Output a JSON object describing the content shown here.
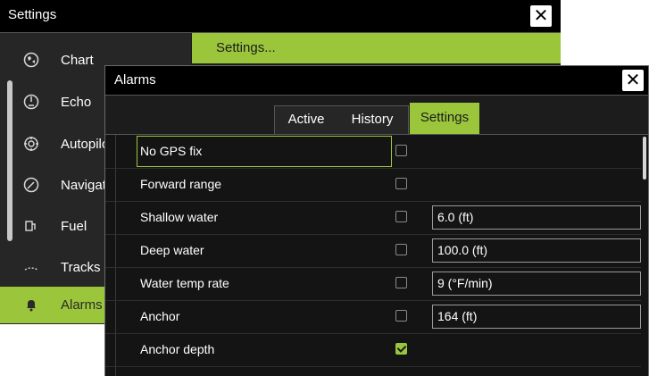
{
  "settings_window": {
    "title": "Settings",
    "close_label": "✕",
    "header_text": "Settings...",
    "sidebar": [
      {
        "label": "Chart",
        "icon": "globe-icon",
        "glyph": "🌐"
      },
      {
        "label": "Echo",
        "icon": "sonar-icon",
        "glyph": "◔"
      },
      {
        "label": "Autopilot",
        "icon": "helm-icon",
        "glyph": "⎈"
      },
      {
        "label": "Navigation",
        "icon": "compass-icon",
        "glyph": "⊘"
      },
      {
        "label": "Fuel",
        "icon": "fuel-pump-icon",
        "glyph": "⛽"
      },
      {
        "label": "Tracks",
        "icon": "track-icon",
        "glyph": "⤳"
      },
      {
        "label": "Alarms",
        "icon": "bell-icon",
        "glyph": "🔔"
      }
    ]
  },
  "alarms_dialog": {
    "title": "Alarms",
    "close_label": "✕",
    "tabs": [
      {
        "label": "Active",
        "active": false
      },
      {
        "label": "History",
        "active": false
      },
      {
        "label": "Settings",
        "active": true
      }
    ],
    "rows": [
      {
        "name": "No GPS fix",
        "checked": false,
        "value": null
      },
      {
        "name": "Forward range",
        "checked": false,
        "value": null
      },
      {
        "name": "Shallow water",
        "checked": false,
        "value": "6.0 (ft)"
      },
      {
        "name": "Deep water",
        "checked": false,
        "value": "100.0 (ft)"
      },
      {
        "name": "Water temp rate",
        "checked": false,
        "value": "9 (°F/min)"
      },
      {
        "name": "Anchor",
        "checked": false,
        "value": "164 (ft)"
      },
      {
        "name": "Anchor depth",
        "checked": true,
        "value": null
      }
    ]
  },
  "colors": {
    "accent": "#9bc63c",
    "background": "#1c1c1c",
    "titlebar": "#000000"
  }
}
